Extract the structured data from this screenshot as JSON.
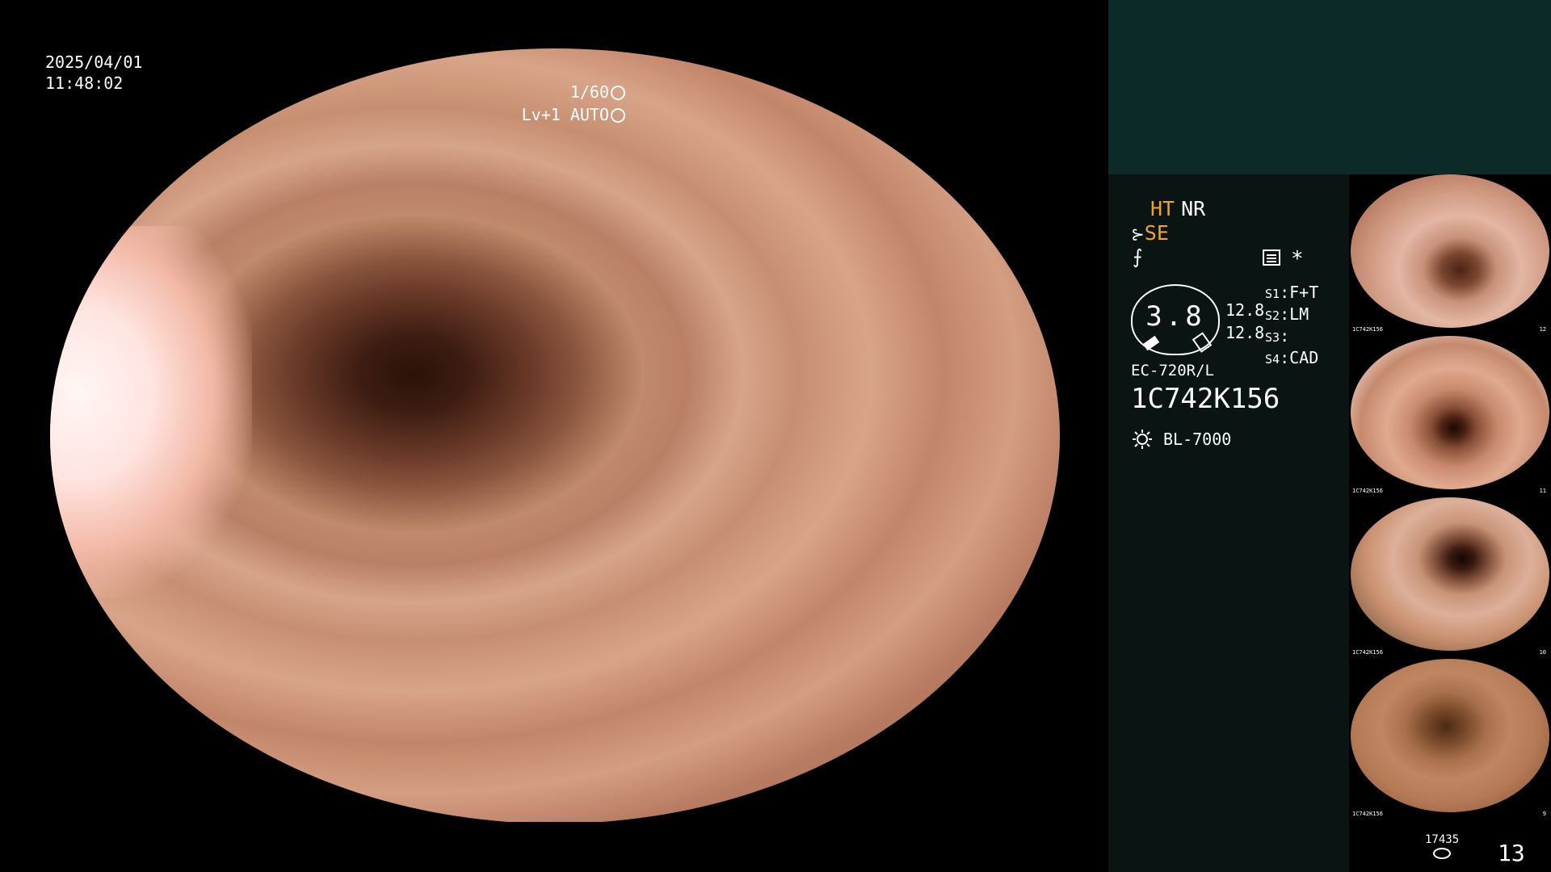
{
  "main": {
    "date": "2025/04/01",
    "time": "11:48:02",
    "shutter": "1/60",
    "shutter_icon": "aperture-icon",
    "mode": "Lv+1 AUTO",
    "mode_icon": "auto-target-icon"
  },
  "status": {
    "ht": "HT",
    "nr": "NR",
    "se": "SE",
    "se_icon": "scope-tip-icon",
    "freeze_icon": "freeze-icon",
    "memo_icon": "memo-grid-icon",
    "asterisk": "*"
  },
  "gauge": {
    "value": "3.8",
    "ratio_top": "12.8",
    "ratio_bottom": "12.8"
  },
  "slots": [
    {
      "key": "S1",
      "value": "F+T"
    },
    {
      "key": "S2",
      "value": "LM"
    },
    {
      "key": "S3",
      "value": ""
    },
    {
      "key": "S4",
      "value": "CAD"
    }
  ],
  "scope": {
    "model": "EC-720R/L",
    "serial": "1C742K156",
    "light_icon": "light-source-icon",
    "light": "BL-7000"
  },
  "thumbnails": [
    {
      "caption": "1C742K156",
      "index": "12"
    },
    {
      "caption": "1C742K156",
      "index": "11"
    },
    {
      "caption": "1C742K156",
      "index": "10"
    },
    {
      "caption": "1C742K156",
      "index": "9"
    }
  ],
  "footer": {
    "storage_count": "17435",
    "storage_icon": "storage-icon",
    "image_count": "13"
  },
  "colors": {
    "accent_orange": "#f0a22c",
    "panel_teal": "#0c2a28",
    "panel_dark": "#0a1413"
  }
}
